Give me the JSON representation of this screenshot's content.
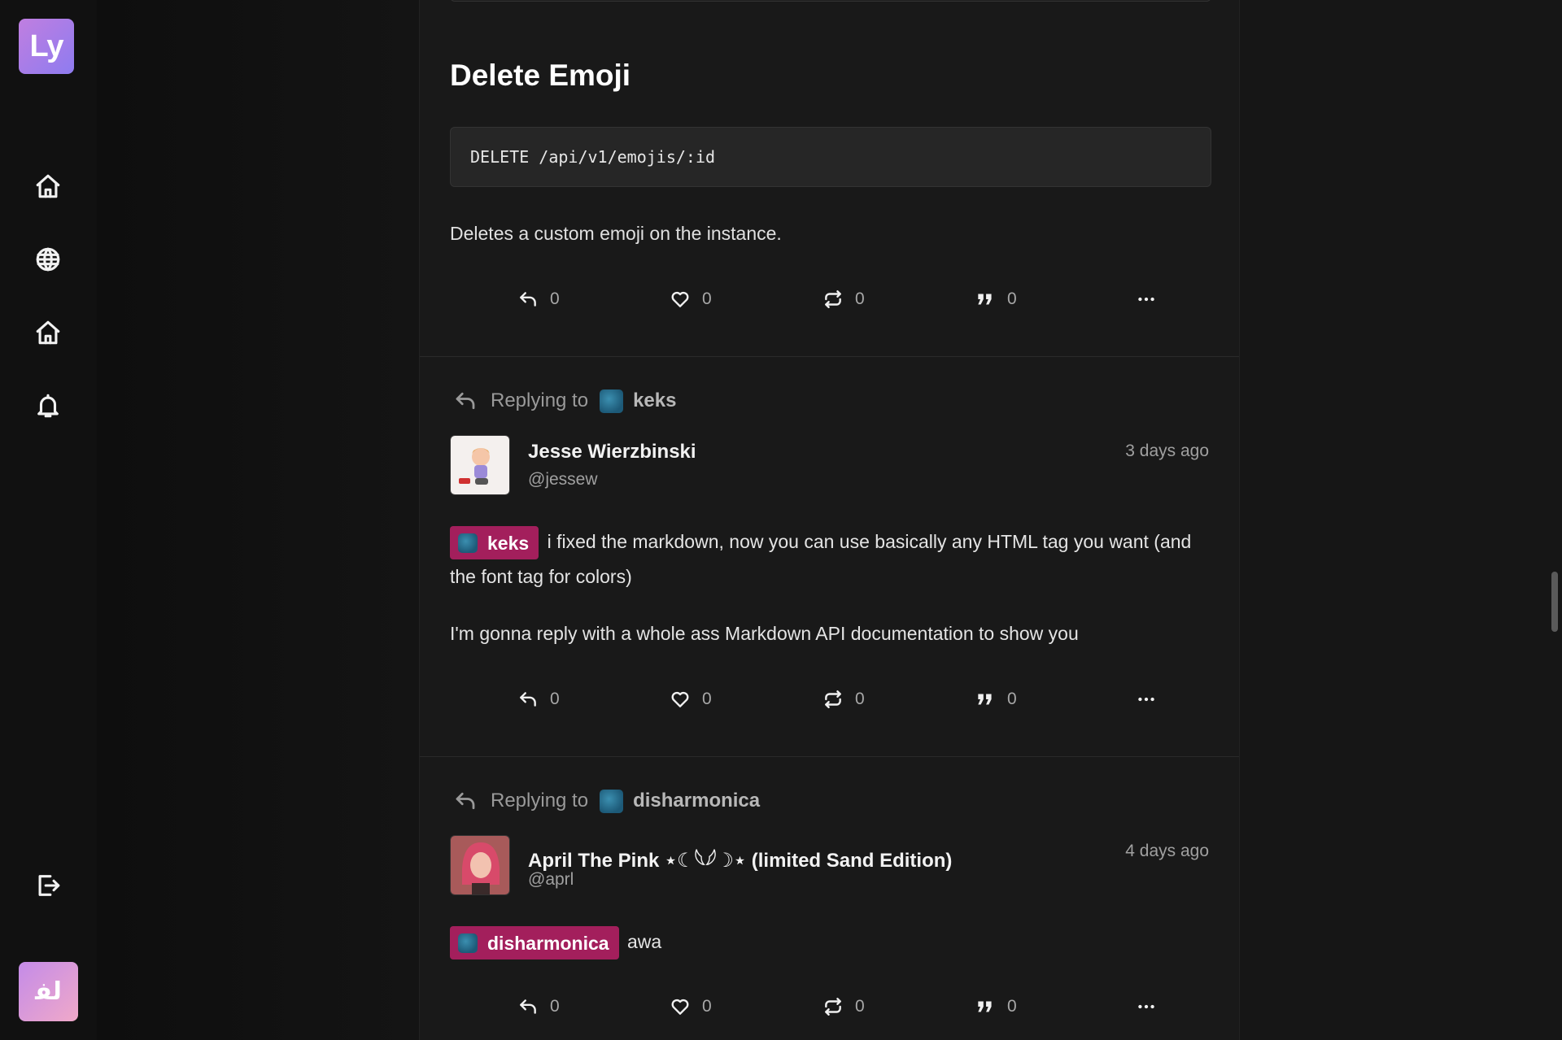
{
  "sidebar": {
    "logo_text": "Ly",
    "nav": [
      {
        "icon": "home-icon"
      },
      {
        "icon": "globe-icon"
      },
      {
        "icon": "home-icon"
      },
      {
        "icon": "bell-icon"
      }
    ],
    "logout_icon": "logout-icon",
    "user_avatar_text": "ﻟﻔ"
  },
  "doc_section": {
    "title": "Delete Emoji",
    "code": "DELETE /api/v1/emojis/:id",
    "description": "Deletes a custom emoji on the instance.",
    "actions": {
      "reply": "0",
      "like": "0",
      "boost": "0",
      "quote": "0"
    }
  },
  "posts": [
    {
      "replying_label": "Replying to",
      "replying_to": "keks",
      "author": "Jesse Wierzbinski",
      "handle": "@jessew",
      "time": "3 days ago",
      "mention": "keks",
      "text_after_mention": "i fixed the markdown, now you can use basically any HTML tag you want (and the font tag for colors)",
      "paragraph2": "I'm gonna reply with a whole ass Markdown API documentation to show you",
      "actions": {
        "reply": "0",
        "like": "0",
        "boost": "0",
        "quote": "0"
      }
    },
    {
      "replying_label": "Replying to",
      "replying_to": "disharmonica",
      "author": "April The Pink ⋆☾𓆩𓆪☽⋆ (limited Sand Edition)",
      "handle": "@aprl",
      "time": "4 days ago",
      "mention": "disharmonica",
      "text_after_mention": "awa",
      "actions": {
        "reply": "0",
        "like": "0",
        "boost": "0",
        "quote": "0"
      }
    }
  ],
  "colors": {
    "background": "#151515",
    "feed": "#191919",
    "mention": "#a31f5c",
    "logo_gradient": [
      "#c07ee0",
      "#8e7cf0"
    ]
  }
}
